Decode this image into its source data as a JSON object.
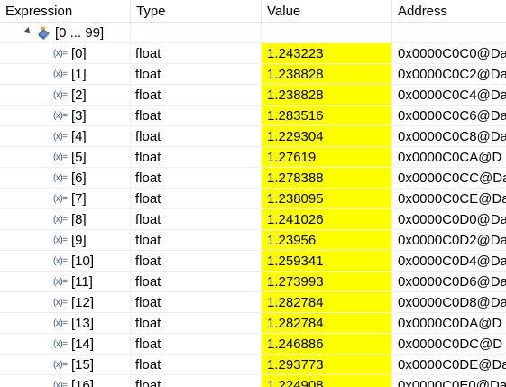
{
  "columns": {
    "expression": "Expression",
    "type": "Type",
    "value": "Value",
    "address": "Address"
  },
  "group": {
    "label": "[0 ... 99]",
    "icon": "array-icon",
    "expanded": true
  },
  "element_icon_glyph": "(x)=",
  "highlight_color": "#ffff00",
  "rows": [
    {
      "index": "[0]",
      "type": "float",
      "value": "1.243223",
      "address": "0x0000C0C0@Da"
    },
    {
      "index": "[1]",
      "type": "float",
      "value": "1.238828",
      "address": "0x0000C0C2@Da"
    },
    {
      "index": "[2]",
      "type": "float",
      "value": "1.238828",
      "address": "0x0000C0C4@Da"
    },
    {
      "index": "[3]",
      "type": "float",
      "value": "1.283516",
      "address": "0x0000C0C6@Da"
    },
    {
      "index": "[4]",
      "type": "float",
      "value": "1.229304",
      "address": "0x0000C0C8@Da"
    },
    {
      "index": "[5]",
      "type": "float",
      "value": "1.27619",
      "address": "0x0000C0CA@D"
    },
    {
      "index": "[6]",
      "type": "float",
      "value": "1.278388",
      "address": "0x0000C0CC@Da"
    },
    {
      "index": "[7]",
      "type": "float",
      "value": "1.238095",
      "address": "0x0000C0CE@Da"
    },
    {
      "index": "[8]",
      "type": "float",
      "value": "1.241026",
      "address": "0x0000C0D0@Da"
    },
    {
      "index": "[9]",
      "type": "float",
      "value": "1.23956",
      "address": "0x0000C0D2@Da"
    },
    {
      "index": "[10]",
      "type": "float",
      "value": "1.259341",
      "address": "0x0000C0D4@Da"
    },
    {
      "index": "[11]",
      "type": "float",
      "value": "1.273993",
      "address": "0x0000C0D6@Da"
    },
    {
      "index": "[12]",
      "type": "float",
      "value": "1.282784",
      "address": "0x0000C0D8@Da"
    },
    {
      "index": "[13]",
      "type": "float",
      "value": "1.282784",
      "address": "0x0000C0DA@D"
    },
    {
      "index": "[14]",
      "type": "float",
      "value": "1.246886",
      "address": "0x0000C0DC@D"
    },
    {
      "index": "[15]",
      "type": "float",
      "value": "1.293773",
      "address": "0x0000C0DE@Da"
    },
    {
      "index": "[16]",
      "type": "float",
      "value": "1.224908",
      "address": "0x0000C0E0@Da"
    }
  ]
}
